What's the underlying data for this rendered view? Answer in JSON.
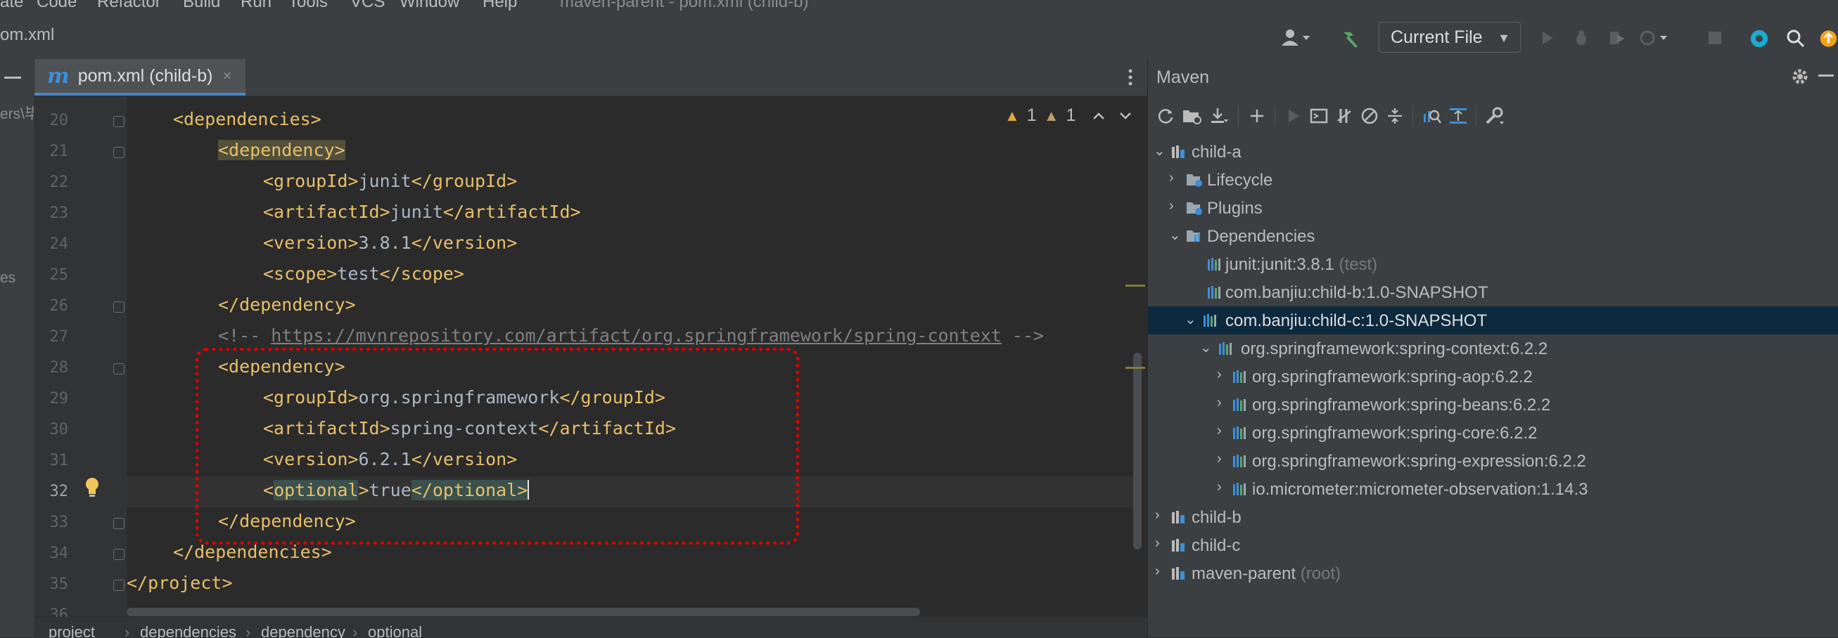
{
  "menubar": {
    "items": [
      "ate",
      "Code",
      "Refactor",
      "Build",
      "Run",
      "Tools",
      "VCS",
      "Window",
      "Help"
    ],
    "window_title": "maven-parent - pom.xml (child-b)"
  },
  "navbar": {
    "breadcrumb": "om.xml",
    "run_config": "Current File"
  },
  "left_strip": {
    "frag1": "ers\\毕",
    "frag2": "es"
  },
  "editor_tab": {
    "icon": "m",
    "label": "pom.xml (child-b)",
    "close": "×"
  },
  "inspection": {
    "warnings": "1",
    "weak_warnings": "1"
  },
  "editor": {
    "line_numbers": [
      "20",
      "21",
      "22",
      "23",
      "24",
      "25",
      "26",
      "27",
      "28",
      "29",
      "30",
      "31",
      "32",
      "33",
      "34",
      "35",
      "36"
    ],
    "lines": {
      "l20": "<dependencies>",
      "l21": "<dependency>",
      "l22a": "<groupId>",
      "l22b": "junit",
      "l22c": "</groupId>",
      "l23a": "<artifactId>",
      "l23b": "junit",
      "l23c": "</artifactId>",
      "l24a": "<version>",
      "l24b": "3.8.1",
      "l24c": "</version>",
      "l25a": "<scope>",
      "l25b": "test",
      "l25c": "</scope>",
      "l26": "</dependency>",
      "l27a": "<!-- ",
      "l27b": "https://mvnrepository.com/artifact/org.springframework/spring-context",
      "l27c": " -->",
      "l28": "<dependency>",
      "l29a": "<groupId>",
      "l29b": "org.springframework",
      "l29c": "</groupId>",
      "l30a": "<artifactId>",
      "l30b": "spring-context",
      "l30c": "</artifactId>",
      "l31a": "<version>",
      "l31b": "6.2.1",
      "l31c": "</version>",
      "l32a": "<",
      "l32b": "optional",
      "l32c": ">",
      "l32d": "true",
      "l32e": "</optional>",
      "l33": "</dependency>",
      "l34": "</dependencies>",
      "l35": "</project>"
    }
  },
  "breadcrumbs": [
    "project",
    "dependencies",
    "dependency",
    "optional"
  ],
  "maven": {
    "title": "Maven",
    "tree": {
      "child_a": "child-a",
      "lifecycle": "Lifecycle",
      "plugins": "Plugins",
      "dependencies": "Dependencies",
      "junit": "junit:junit:3.8.1",
      "junit_scope": "(test)",
      "child_b_dep": "com.banjiu:child-b:1.0-SNAPSHOT",
      "child_c_dep": "com.banjiu:child-c:1.0-SNAPSHOT",
      "spring_context": "org.springframework:spring-context:6.2.2",
      "spring_aop": "org.springframework:spring-aop:6.2.2",
      "spring_beans": "org.springframework:spring-beans:6.2.2",
      "spring_core": "org.springframework:spring-core:6.2.2",
      "spring_expression": "org.springframework:spring-expression:6.2.2",
      "micrometer": "io.micrometer:micrometer-observation:1.14.3",
      "child_b": "child-b",
      "child_c": "child-c",
      "maven_parent": "maven-parent",
      "root_label": "(root)"
    }
  },
  "colors": {
    "editor_bg": "#2b2b2b",
    "panel_bg": "#3c3f41",
    "tag": "#e8bf6a",
    "text": "#a9b7c6",
    "selection": "#0d293e",
    "annotation_box": "#e00000"
  }
}
